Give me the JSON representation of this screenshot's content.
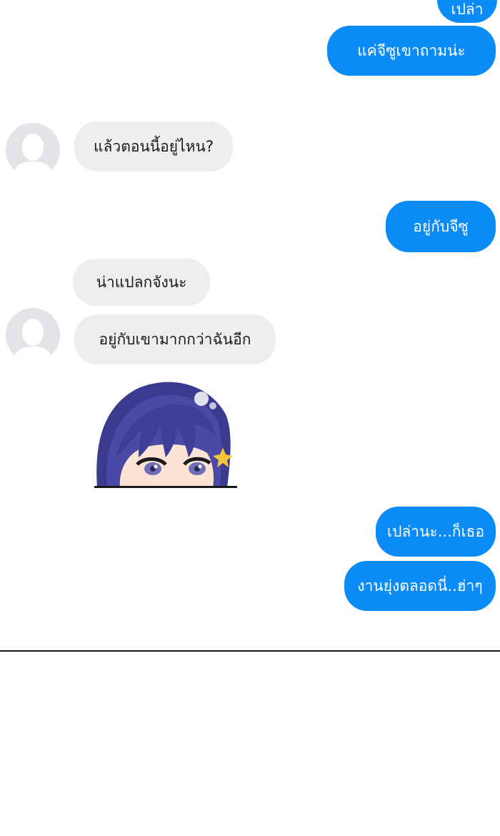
{
  "messages": {
    "m0": "เปล่า",
    "m1": "แค่จีซูเขาถามน่ะ",
    "m2": "แล้วตอนนี้อยู่ไหน?",
    "m3": "อยู่กับจีซู",
    "m4": "น่าแปลกจังนะ",
    "m5": "อยู่กับเขามากกว่าฉันอีก",
    "m6": "เปล่านะ...ก็เธอ",
    "m7": "งานยุ่งตลอดนี่..ฮ่าๆ"
  },
  "colors": {
    "outgoing_bubble": "#0b8bf5",
    "incoming_bubble": "#eeeeef",
    "avatar_placeholder": "#e2e4ea"
  },
  "icons": {
    "avatar": "default-user-silhouette-icon"
  }
}
